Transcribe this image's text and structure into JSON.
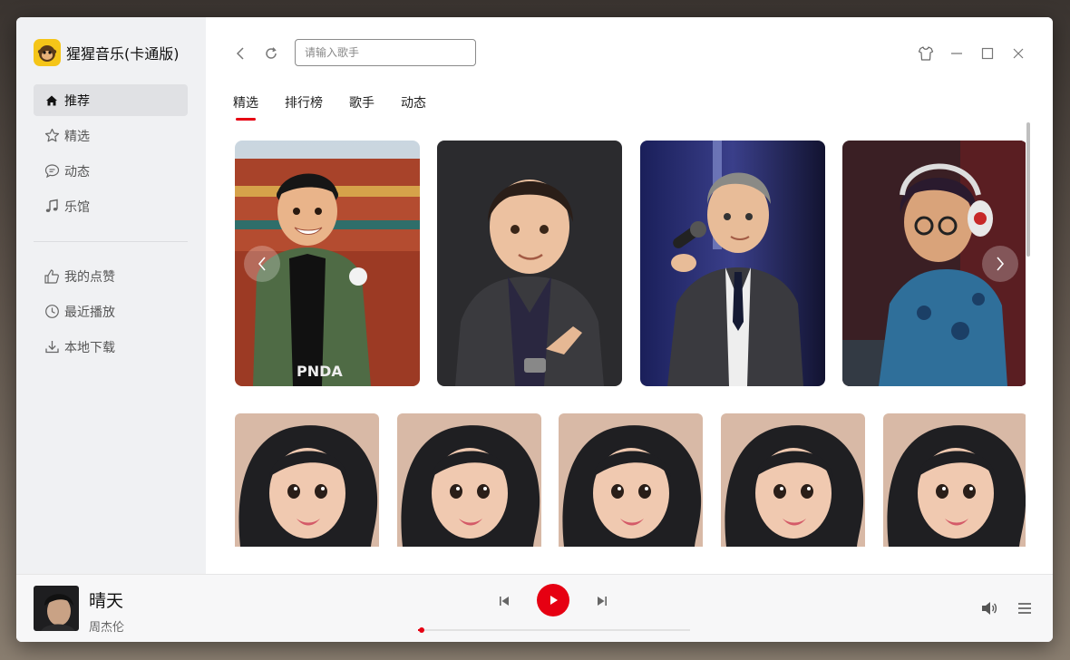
{
  "app": {
    "title": "猩猩音乐(卡通版)",
    "accent_color": "#e60012",
    "logo_color": "#f5c518"
  },
  "sidebar": {
    "primary": [
      {
        "label": "推荐",
        "icon": "home-icon",
        "active": true
      },
      {
        "label": "精选",
        "icon": "star-icon",
        "active": false
      },
      {
        "label": "动态",
        "icon": "chat-bubble-icon",
        "active": false
      },
      {
        "label": "乐馆",
        "icon": "music-note-icon",
        "active": false
      }
    ],
    "secondary": [
      {
        "label": "我的点赞",
        "icon": "thumbs-up-icon"
      },
      {
        "label": "最近播放",
        "icon": "clock-icon"
      },
      {
        "label": "本地下载",
        "icon": "download-icon"
      }
    ]
  },
  "toolbar": {
    "search_placeholder": "请输入歌手",
    "search_value": ""
  },
  "tabs": [
    {
      "label": "精选",
      "active": true
    },
    {
      "label": "排行榜",
      "active": false
    },
    {
      "label": "歌手",
      "active": false
    },
    {
      "label": "动态",
      "active": false
    }
  ],
  "featured_cards": [
    {
      "icon": "cartoon-singer-green-jacket-portrait"
    },
    {
      "icon": "cartoon-man-suit-portrait"
    },
    {
      "icon": "cartoon-singer-microphone-portrait"
    },
    {
      "icon": "cartoon-dj-headphones-portrait"
    }
  ],
  "artist_cards": [
    {
      "icon": "cartoon-woman-portrait"
    },
    {
      "icon": "cartoon-woman-portrait"
    },
    {
      "icon": "cartoon-woman-portrait"
    },
    {
      "icon": "cartoon-woman-portrait"
    },
    {
      "icon": "cartoon-woman-portrait"
    }
  ],
  "player": {
    "song_title": "晴天",
    "artist": "周杰伦",
    "progress": 0.01,
    "is_playing": false
  }
}
